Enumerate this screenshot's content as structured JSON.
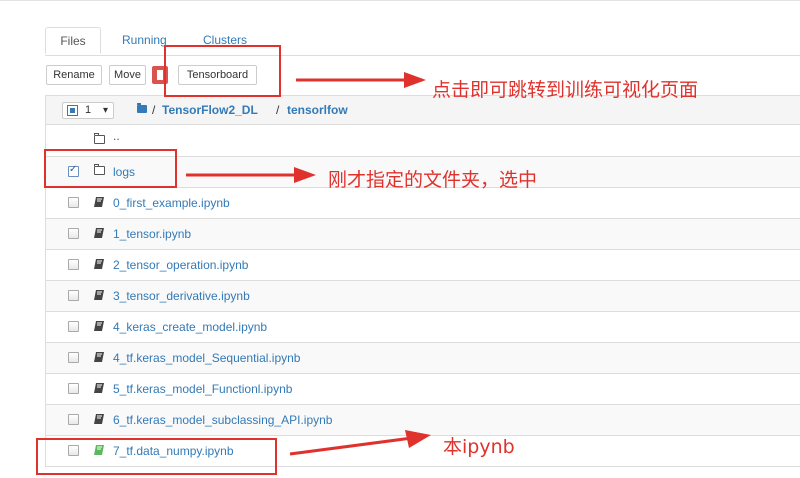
{
  "tabs": [
    {
      "label": "Files"
    },
    {
      "label": "Running"
    },
    {
      "label": "Clusters"
    }
  ],
  "toolbar": {
    "rename_label": "Rename",
    "move_label": "Move",
    "tensorboard_label": "Tensorboard"
  },
  "breadcrumb": {
    "selected_count": "1",
    "sep": "/",
    "folder1": "TensorFlow2_DL",
    "folder2": "tensorlfow"
  },
  "files": {
    "updir": "..",
    "rows": [
      {
        "name": "logs",
        "type": "folder",
        "checked": true
      },
      {
        "name": "0_first_example.ipynb",
        "type": "notebook"
      },
      {
        "name": "1_tensor.ipynb",
        "type": "notebook"
      },
      {
        "name": "2_tensor_operation.ipynb",
        "type": "notebook"
      },
      {
        "name": "3_tensor_derivative.ipynb",
        "type": "notebook"
      },
      {
        "name": "4_keras_create_model.ipynb",
        "type": "notebook"
      },
      {
        "name": "4_tf.keras_model_Sequential.ipynb",
        "type": "notebook"
      },
      {
        "name": "5_tf.keras_model_Functionl.ipynb",
        "type": "notebook"
      },
      {
        "name": "6_tf.keras_model_subclassing_API.ipynb",
        "type": "notebook"
      },
      {
        "name": "7_tf.data_numpy.ipynb",
        "type": "notebook",
        "running": true
      }
    ]
  },
  "annotations": {
    "tensorboard_note": "点击即可跳转到训练可视化页面",
    "logs_note": "刚才指定的文件夹，选中",
    "notebook_note": "本ipynb"
  },
  "colors": {
    "link": "#337ab7",
    "annotation_red": "#e0322d",
    "delete_button": "#d9534f",
    "running_notebook": "#5cb85c"
  }
}
